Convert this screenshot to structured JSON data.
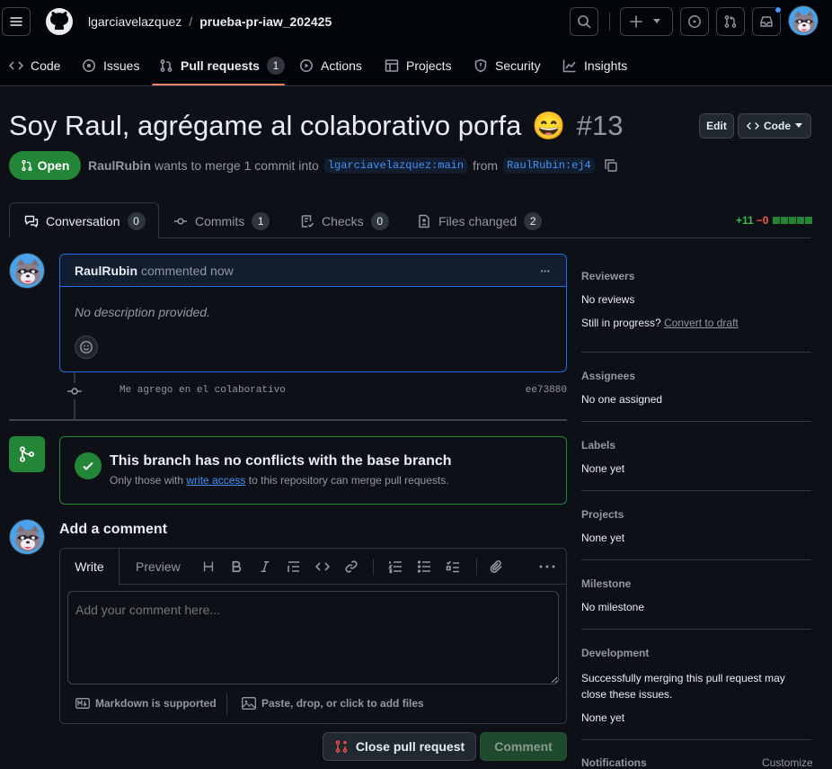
{
  "header": {
    "owner": "lgarciavelazquez",
    "separator": "/",
    "repo": "prueba-pr-iaw_202425",
    "plus_label": "+"
  },
  "repo_nav": [
    {
      "label": "Code",
      "icon": "code-icon"
    },
    {
      "label": "Issues",
      "icon": "issue-opened-icon"
    },
    {
      "label": "Pull requests",
      "icon": "git-pull-request-icon",
      "count": "1",
      "selected": true
    },
    {
      "label": "Actions",
      "icon": "play-icon"
    },
    {
      "label": "Projects",
      "icon": "table-icon"
    },
    {
      "label": "Security",
      "icon": "shield-icon"
    },
    {
      "label": "Insights",
      "icon": "graph-icon"
    }
  ],
  "pr": {
    "title": "Soy Raul, agrégame al colaborativo porfa",
    "emoji": "😄",
    "number": "#13",
    "edit_label": "Edit",
    "code_label": "Code",
    "state": "Open",
    "author": "RaulRubin",
    "merge_text": "wants to merge 1 commit into",
    "base_branch": "lgarciavelazquez:main",
    "from_text": "from",
    "head_branch": "RaulRubin:ej4"
  },
  "pr_tabs": [
    {
      "label": "Conversation",
      "count": "0",
      "icon": "comment-discussion-icon",
      "selected": true
    },
    {
      "label": "Commits",
      "count": "1",
      "icon": "git-commit-icon"
    },
    {
      "label": "Checks",
      "count": "0",
      "icon": "checklist-icon"
    },
    {
      "label": "Files changed",
      "count": "2",
      "icon": "file-diff-icon"
    }
  ],
  "diffstat": {
    "additions": "+11",
    "deletions": "−0"
  },
  "comment": {
    "author": "RaulRubin",
    "action": "commented now",
    "body": "No description provided.",
    "more": "···"
  },
  "commit": {
    "message": "Me agrego en el colaborativo",
    "sha": "ee73880"
  },
  "merge_box": {
    "title": "This branch has no conflicts with the base branch",
    "desc_pre": "Only those with",
    "desc_link": "write access",
    "desc_post": "to this repository can merge pull requests."
  },
  "add_comment": {
    "heading": "Add a comment",
    "write_tab": "Write",
    "preview_tab": "Preview",
    "placeholder": "Add your comment here...",
    "markdown_note": "Markdown is supported",
    "attach_note": "Paste, drop, or click to add files",
    "close_button": "Close pull request",
    "comment_button": "Comment"
  },
  "sidebar": {
    "reviewers": {
      "heading": "Reviewers",
      "value": "No reviews",
      "progress_text": "Still in progress?",
      "draft_link": "Convert to draft"
    },
    "assignees": {
      "heading": "Assignees",
      "value": "No one assigned"
    },
    "labels": {
      "heading": "Labels",
      "value": "None yet"
    },
    "projects": {
      "heading": "Projects",
      "value": "None yet"
    },
    "milestone": {
      "heading": "Milestone",
      "value": "No milestone"
    },
    "development": {
      "heading": "Development",
      "description": "Successfully merging this pull request may close these issues.",
      "value": "None yet"
    },
    "notifications": {
      "heading": "Notifications",
      "customize": "Customize"
    }
  },
  "colors": {
    "accent": "#4493f8",
    "open_green": "#238636",
    "underline": "#f78166",
    "delete_red": "#f85149"
  }
}
